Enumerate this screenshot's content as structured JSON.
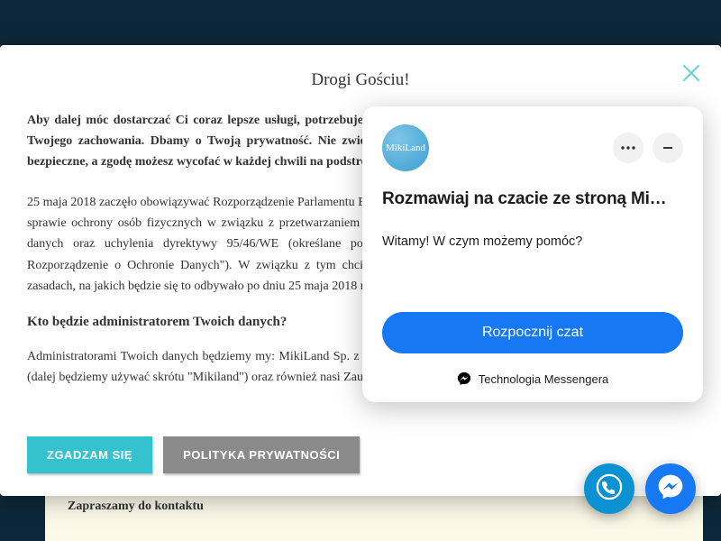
{
  "modal": {
    "title": "Drogi Gościu!",
    "bold_intro": "Aby dalej móc dostarczać Ci coraz lepsze usługi, potrzebujemy zgody na lepsze dopasowanie treści marketingowych do Twojego zachowania. Dbamy o Twoją prywatność. Nie zwiększamy zakresu naszych uprawnień. Twoje dane są u nas bezpieczne, a zgodę możesz wycofać w każdej chwili na podstronie polityka prywatności.",
    "body1": "25 maja 2018 zaczęło obowiązywać Rozporządzenie Parlamentu Europejskiego i Rady (UE) 2016/679 z dnia 27 kwietnia 2016 r. w sprawie ochrony osób fizycznych w związku z przetwarzaniem danych osobowych i w sprawie swobodnego przepływu takich danych oraz uchylenia dyrektywy 95/46/WE (określane popularnie jako \"RODO\", \"ORODO\", \"GDPR\" lub \"Ogólne Rozporządzenie o Ochronie Danych\"). W związku z tym chcielibyśmy poinformować o przetwarzaniu Twoich danych oraz zasadach, na jakich będzie się to odbywało po dniu 25 maja 2018 roku. Poniżej znajdziesz podstawowe informacje na ten temat.",
    "subtitle": "Kto będzie administratorem Twoich danych?",
    "body2": "Administratorami Twoich danych będziemy my: MikiLand Sp. z o.o., Aleje Jerozolimskie 81, 02-001 Warszawa, NIP 701-00-799 (dalej będziemy używać skrótu \"Mikiland\") oraz również nasi Zaufani Partnerzy czyli firmy i inne",
    "agree_label": "ZGADZAM SIĘ",
    "privacy_label": "POLITYKA PRYWATNOŚCI"
  },
  "chat": {
    "avatar_text": "MikiLand",
    "title": "Rozmawiaj na czacie ze stroną Mi…",
    "welcome": "Witamy! W czym możemy pomóc?",
    "start_label": "Rozpocznij czat",
    "footer_label": "Technologia Messengera"
  },
  "page": {
    "contact_text": "Zapraszamy do kontaktu"
  },
  "colors": {
    "background": "#0c2838",
    "accent_cyan": "#35c2cf",
    "messenger_blue": "#1778f4"
  }
}
